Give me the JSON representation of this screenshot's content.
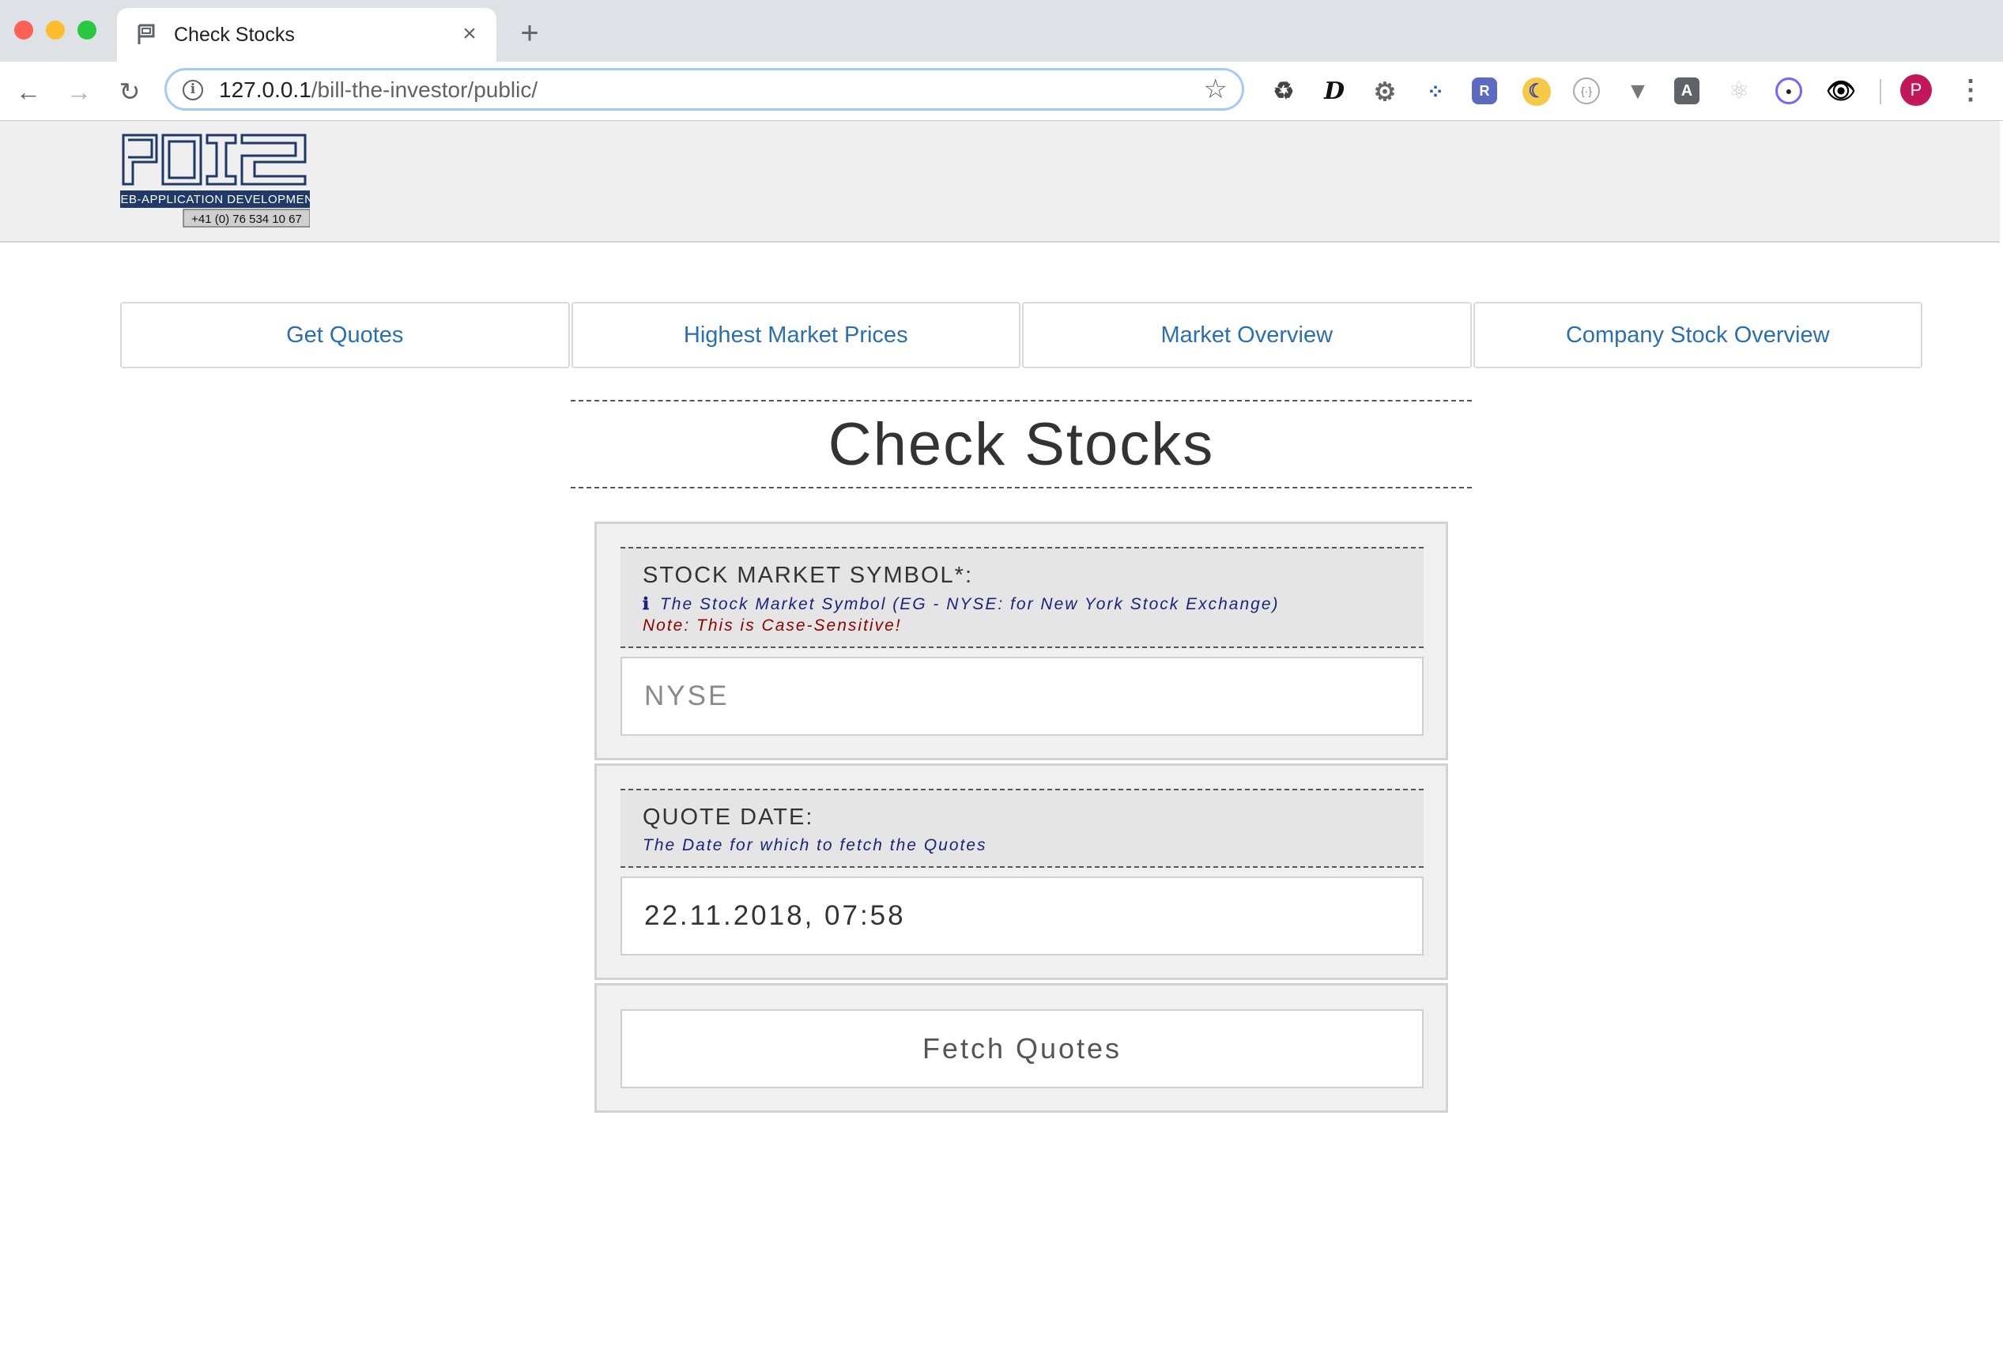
{
  "browser": {
    "tab_title": "Check Stocks",
    "new_tab_symbol": "+",
    "close_symbol": "×",
    "url_host": "127.0.0.1",
    "url_path": "/bill-the-investor/public/",
    "profile_initial": "P",
    "extensions": [
      "recycle-icon",
      "d-logo-icon",
      "gear-icon",
      "dots-icon",
      "r-badge-icon",
      "moon-icon",
      "braces-icon",
      "vue-icon",
      "angular-icon",
      "react-icon",
      "target-icon",
      "eye-icon"
    ]
  },
  "header": {
    "logo_text": "POI2",
    "logo_subtitle": "WEB-APPLICATION DEVELOPMENT",
    "logo_phone": "+41 (0) 76 534 10 67"
  },
  "nav": {
    "items": [
      {
        "label": "Get Quotes"
      },
      {
        "label": "Highest Market Prices"
      },
      {
        "label": "Market Overview"
      },
      {
        "label": "Company Stock Overview"
      }
    ]
  },
  "main": {
    "title": "Check Stocks",
    "symbol_field": {
      "label": "STOCK MARKET SYMBOL*:",
      "hint_icon": "info-icon",
      "hint": "The Stock Market Symbol (EG - NYSE: for New York Stock Exchange)",
      "note": "Note: This is Case-Sensitive!",
      "placeholder": "NYSE",
      "value": ""
    },
    "date_field": {
      "label": "QUOTE DATE:",
      "hint": "The Date for which to fetch the Quotes",
      "value": "22.11.2018, 07:58"
    },
    "submit_label": "Fetch Quotes"
  },
  "colors": {
    "nav_link": "#2a6fb0",
    "hint_text": "#1a237e",
    "note_text": "#8b0000",
    "logo_navy": "#1f3a68"
  }
}
